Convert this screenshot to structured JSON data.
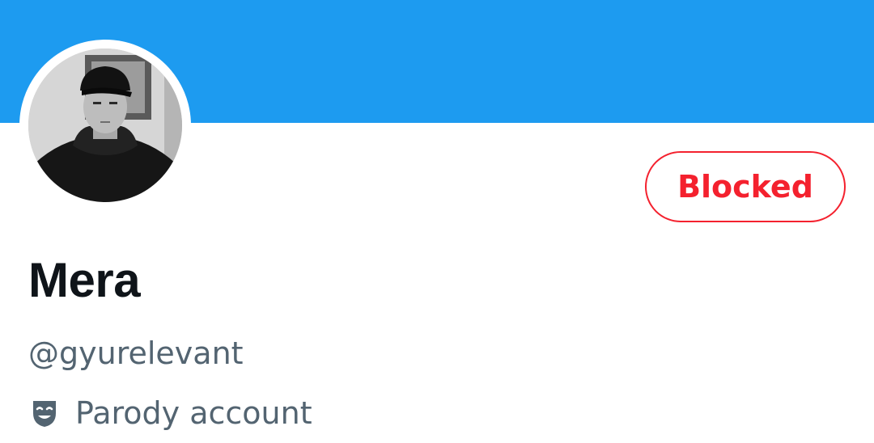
{
  "colors": {
    "banner": "#1d9bf0",
    "blocked_accent": "#f4212e",
    "name_text": "#0f1419",
    "secondary_text": "#536471"
  },
  "profile": {
    "display_name": "Mera",
    "handle": "@gyurelevant",
    "parody_label": "Parody account",
    "parody_icon": "theater-masks-icon",
    "avatar": "avatar-photo"
  },
  "actions": {
    "blocked_label": "Blocked"
  }
}
